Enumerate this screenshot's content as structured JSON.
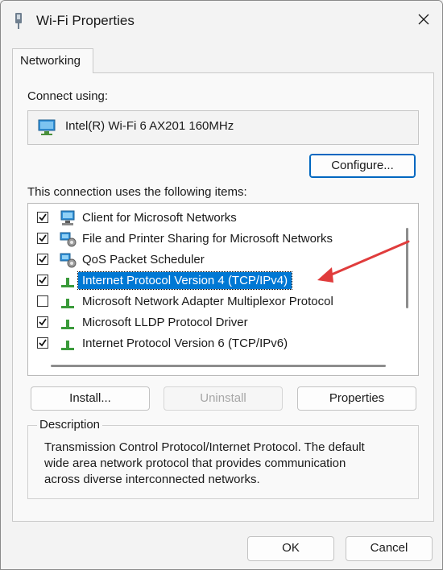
{
  "window": {
    "title": "Wi-Fi Properties"
  },
  "tabs": [
    {
      "label": "Networking"
    }
  ],
  "connect": {
    "label": "Connect using:",
    "adapter": "Intel(R) Wi-Fi 6 AX201 160MHz",
    "configure_label": "Configure..."
  },
  "items": {
    "label": "This connection uses the following items:",
    "list": [
      {
        "label": "Client for Microsoft Networks",
        "checked": true,
        "icon": "network-client-icon"
      },
      {
        "label": "File and Printer Sharing for Microsoft Networks",
        "checked": true,
        "icon": "network-service-icon"
      },
      {
        "label": "QoS Packet Scheduler",
        "checked": true,
        "icon": "network-service-icon"
      },
      {
        "label": "Internet Protocol Version 4 (TCP/IPv4)",
        "checked": true,
        "icon": "protocol-icon",
        "selected": true
      },
      {
        "label": "Microsoft Network Adapter Multiplexor Protocol",
        "checked": false,
        "icon": "protocol-icon"
      },
      {
        "label": "Microsoft LLDP Protocol Driver",
        "checked": true,
        "icon": "protocol-icon"
      },
      {
        "label": "Internet Protocol Version 6 (TCP/IPv6)",
        "checked": true,
        "icon": "protocol-icon"
      }
    ]
  },
  "buttons": {
    "install": "Install...",
    "uninstall": "Uninstall",
    "properties": "Properties",
    "ok": "OK",
    "cancel": "Cancel"
  },
  "description": {
    "legend": "Description",
    "line1": "Transmission Control Protocol/Internet Protocol. The default",
    "line2": "wide area network protocol that provides communication",
    "line3": "across diverse interconnected networks."
  },
  "colors": {
    "selection": "#0078d4",
    "annotation_arrow": "#e03c3c",
    "default_button_border": "#0067c0"
  }
}
